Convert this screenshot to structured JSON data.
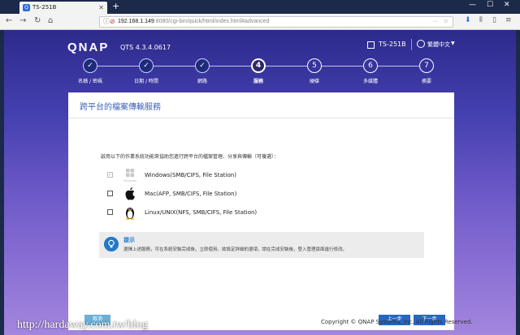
{
  "browser": {
    "tab_title": "TS-251B",
    "tab_favicon": "Q",
    "url_host": "192.168.1.149",
    "url_path": ":8080/cgi-bin/quick/html/index.html#advanced"
  },
  "header": {
    "logo": "QNAP",
    "version": "QTS 4.3.4.0617",
    "model": "TS-251B",
    "language": "繁體中文"
  },
  "steps": [
    {
      "symbol": "✓",
      "label": "名稱 / 密碼",
      "state": "done"
    },
    {
      "symbol": "✓",
      "label": "日期 / 時間",
      "state": "done"
    },
    {
      "symbol": "✓",
      "label": "網路",
      "state": "done"
    },
    {
      "symbol": "4",
      "label": "服務",
      "state": "current"
    },
    {
      "symbol": "5",
      "label": "硬碟",
      "state": "todo"
    },
    {
      "symbol": "6",
      "label": "多媒體",
      "state": "todo"
    },
    {
      "symbol": "7",
      "label": "摘要",
      "state": "todo"
    }
  ],
  "main": {
    "title": "跨平台的檔案傳輸服務",
    "description": "啟用以下的作業系統功能來協助您進行跨平台的檔案管理、分享與傳輸（可複選）：",
    "options": [
      {
        "label": "Windows(SMB/CIFS, File Station)",
        "icon": "windows-icon",
        "icon_caption": "Windows",
        "checked": true,
        "disabled": true
      },
      {
        "label": "Mac(AFP, SMB/CIFS, File Station)",
        "icon": "apple-icon",
        "checked": false,
        "disabled": false
      },
      {
        "label": "Linux/UNIX(NFS, SMB/CIFS, File Station)",
        "icon": "linux-tux-icon",
        "checked": false,
        "disabled": false
      }
    ],
    "tip_title": "提示",
    "tip_text": "選擇上述服務，可在系統安裝完成後，立即使用。欲設定詳細的選項，請在完成安裝後，登入管理頁面進行修改。",
    "cancel_label": "取消",
    "back_label": "上一步",
    "next_label": "下一步"
  },
  "footer": {
    "copyright": "Copyright © QNAP Systems, Inc. All Rights Reserved.",
    "watermark": "http://hardaway.com.tw/blog"
  }
}
